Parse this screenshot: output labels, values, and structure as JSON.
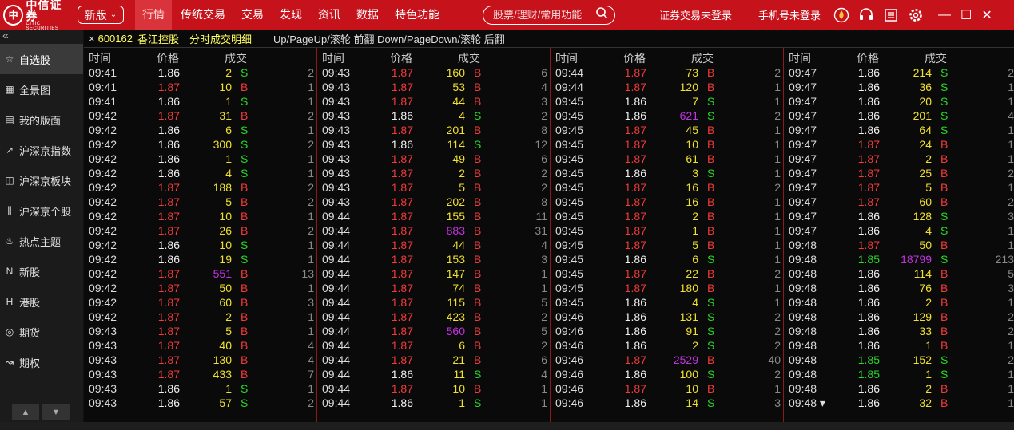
{
  "app": {
    "logo_cn": "中信证券",
    "logo_en": "CITIC SECURITIES",
    "logo_mark": "中"
  },
  "topbar": {
    "version_button": "新版",
    "nav": [
      "行情",
      "传统交易",
      "交易",
      "发现",
      "资讯",
      "数据",
      "特色功能"
    ],
    "active_nav": 0,
    "search_placeholder": "股票/理财/常用功能",
    "trade_login": "证券交易未登录",
    "phone_login": "手机号未登录",
    "icons": [
      "fire-icon",
      "headset-icon",
      "document-icon",
      "gear-icon"
    ],
    "window_buttons": [
      "—",
      "☐",
      "✕"
    ],
    "accent": "#c6121b"
  },
  "sidebar": {
    "collapse": "«",
    "items": [
      {
        "label": "自选股",
        "icon": "star-icon",
        "active": true
      },
      {
        "label": "全景图",
        "icon": "chart-icon",
        "active": false
      },
      {
        "label": "我的版面",
        "icon": "layout-icon",
        "active": false
      },
      {
        "label": "沪深京指数",
        "icon": "trend-icon",
        "active": false
      },
      {
        "label": "沪深京板块",
        "icon": "blocks-icon",
        "active": false
      },
      {
        "label": "沪深京个股",
        "icon": "candle-icon",
        "active": false
      },
      {
        "label": "热点主题",
        "icon": "flame-icon",
        "active": false
      },
      {
        "label": "新股",
        "icon": "new-icon",
        "active": false
      },
      {
        "label": "港股",
        "icon": "hk-icon",
        "active": false
      },
      {
        "label": "期货",
        "icon": "futures-icon",
        "active": false
      },
      {
        "label": "期权",
        "icon": "options-icon",
        "active": false
      }
    ],
    "pager": [
      "▲",
      "▼"
    ]
  },
  "title": {
    "close": "×",
    "code": "600162",
    "name": "香江控股",
    "subtitle": "分时成交明细",
    "hint": "Up/PageUp/滚轮 前翻 Down/PageDown/滚轮 后翻"
  },
  "table": {
    "headers": [
      "时间",
      "价格",
      "成交"
    ],
    "columns": [
      [
        [
          "09:41",
          "1.86",
          "2",
          "S",
          "2"
        ],
        [
          "09:41",
          "1.87",
          "10",
          "B",
          "1"
        ],
        [
          "09:41",
          "1.86",
          "1",
          "S",
          "1"
        ],
        [
          "09:42",
          "1.87",
          "31",
          "B",
          "2"
        ],
        [
          "09:42",
          "1.86",
          "6",
          "S",
          "1"
        ],
        [
          "09:42",
          "1.86",
          "300",
          "S",
          "2"
        ],
        [
          "09:42",
          "1.86",
          "1",
          "S",
          "1"
        ],
        [
          "09:42",
          "1.86",
          "4",
          "S",
          "1"
        ],
        [
          "09:42",
          "1.87",
          "188",
          "B",
          "2"
        ],
        [
          "09:42",
          "1.87",
          "5",
          "B",
          "2"
        ],
        [
          "09:42",
          "1.87",
          "10",
          "B",
          "1"
        ],
        [
          "09:42",
          "1.87",
          "26",
          "B",
          "2"
        ],
        [
          "09:42",
          "1.86",
          "10",
          "S",
          "1"
        ],
        [
          "09:42",
          "1.86",
          "19",
          "S",
          "1"
        ],
        [
          "09:42",
          "1.87",
          "551",
          "B",
          "13"
        ],
        [
          "09:42",
          "1.87",
          "50",
          "B",
          "1"
        ],
        [
          "09:42",
          "1.87",
          "60",
          "B",
          "3"
        ],
        [
          "09:42",
          "1.87",
          "2",
          "B",
          "1"
        ],
        [
          "09:43",
          "1.87",
          "5",
          "B",
          "1"
        ],
        [
          "09:43",
          "1.87",
          "40",
          "B",
          "4"
        ],
        [
          "09:43",
          "1.87",
          "130",
          "B",
          "4"
        ],
        [
          "09:43",
          "1.87",
          "433",
          "B",
          "7"
        ],
        [
          "09:43",
          "1.86",
          "1",
          "S",
          "1"
        ],
        [
          "09:43",
          "1.86",
          "57",
          "S",
          "2"
        ]
      ],
      [
        [
          "09:43",
          "1.87",
          "160",
          "B",
          "6"
        ],
        [
          "09:43",
          "1.87",
          "53",
          "B",
          "4"
        ],
        [
          "09:43",
          "1.87",
          "44",
          "B",
          "3"
        ],
        [
          "09:43",
          "1.86",
          "4",
          "S",
          "2"
        ],
        [
          "09:43",
          "1.87",
          "201",
          "B",
          "8"
        ],
        [
          "09:43",
          "1.86",
          "114",
          "S",
          "12"
        ],
        [
          "09:43",
          "1.87",
          "49",
          "B",
          "6"
        ],
        [
          "09:43",
          "1.87",
          "2",
          "B",
          "2"
        ],
        [
          "09:43",
          "1.87",
          "5",
          "B",
          "2"
        ],
        [
          "09:43",
          "1.87",
          "202",
          "B",
          "8"
        ],
        [
          "09:44",
          "1.87",
          "155",
          "B",
          "11"
        ],
        [
          "09:44",
          "1.87",
          "883",
          "B",
          "31"
        ],
        [
          "09:44",
          "1.87",
          "44",
          "B",
          "4"
        ],
        [
          "09:44",
          "1.87",
          "153",
          "B",
          "3"
        ],
        [
          "09:44",
          "1.87",
          "147",
          "B",
          "1"
        ],
        [
          "09:44",
          "1.87",
          "74",
          "B",
          "1"
        ],
        [
          "09:44",
          "1.87",
          "115",
          "B",
          "5"
        ],
        [
          "09:44",
          "1.87",
          "423",
          "B",
          "2"
        ],
        [
          "09:44",
          "1.87",
          "560",
          "B",
          "5"
        ],
        [
          "09:44",
          "1.87",
          "6",
          "B",
          "2"
        ],
        [
          "09:44",
          "1.87",
          "21",
          "B",
          "6"
        ],
        [
          "09:44",
          "1.86",
          "11",
          "S",
          "4"
        ],
        [
          "09:44",
          "1.87",
          "10",
          "B",
          "1"
        ],
        [
          "09:44",
          "1.86",
          "1",
          "S",
          "1"
        ]
      ],
      [
        [
          "09:44",
          "1.87",
          "73",
          "B",
          "2"
        ],
        [
          "09:44",
          "1.87",
          "120",
          "B",
          "1"
        ],
        [
          "09:45",
          "1.86",
          "7",
          "S",
          "1"
        ],
        [
          "09:45",
          "1.86",
          "621",
          "S",
          "2"
        ],
        [
          "09:45",
          "1.87",
          "45",
          "B",
          "1"
        ],
        [
          "09:45",
          "1.87",
          "10",
          "B",
          "1"
        ],
        [
          "09:45",
          "1.87",
          "61",
          "B",
          "1"
        ],
        [
          "09:45",
          "1.86",
          "3",
          "S",
          "1"
        ],
        [
          "09:45",
          "1.87",
          "16",
          "B",
          "2"
        ],
        [
          "09:45",
          "1.87",
          "16",
          "B",
          "1"
        ],
        [
          "09:45",
          "1.87",
          "2",
          "B",
          "1"
        ],
        [
          "09:45",
          "1.87",
          "1",
          "B",
          "1"
        ],
        [
          "09:45",
          "1.87",
          "5",
          "B",
          "1"
        ],
        [
          "09:45",
          "1.86",
          "6",
          "S",
          "1"
        ],
        [
          "09:45",
          "1.87",
          "22",
          "B",
          "2"
        ],
        [
          "09:45",
          "1.87",
          "180",
          "B",
          "1"
        ],
        [
          "09:45",
          "1.86",
          "4",
          "S",
          "1"
        ],
        [
          "09:46",
          "1.86",
          "131",
          "S",
          "2"
        ],
        [
          "09:46",
          "1.86",
          "91",
          "S",
          "2"
        ],
        [
          "09:46",
          "1.86",
          "2",
          "S",
          "2"
        ],
        [
          "09:46",
          "1.87",
          "2529",
          "B",
          "40"
        ],
        [
          "09:46",
          "1.86",
          "100",
          "S",
          "2"
        ],
        [
          "09:46",
          "1.87",
          "10",
          "B",
          "1"
        ],
        [
          "09:46",
          "1.86",
          "14",
          "S",
          "3"
        ]
      ],
      [
        [
          "09:47",
          "1.86",
          "214",
          "S",
          "2"
        ],
        [
          "09:47",
          "1.86",
          "36",
          "S",
          "1"
        ],
        [
          "09:47",
          "1.86",
          "20",
          "S",
          "1"
        ],
        [
          "09:47",
          "1.86",
          "201",
          "S",
          "4"
        ],
        [
          "09:47",
          "1.86",
          "64",
          "S",
          "1"
        ],
        [
          "09:47",
          "1.87",
          "24",
          "B",
          "1"
        ],
        [
          "09:47",
          "1.87",
          "2",
          "B",
          "1"
        ],
        [
          "09:47",
          "1.87",
          "25",
          "B",
          "2"
        ],
        [
          "09:47",
          "1.87",
          "5",
          "B",
          "1"
        ],
        [
          "09:47",
          "1.87",
          "60",
          "B",
          "2"
        ],
        [
          "09:47",
          "1.86",
          "128",
          "S",
          "3"
        ],
        [
          "09:47",
          "1.86",
          "4",
          "S",
          "1"
        ],
        [
          "09:48",
          "1.87",
          "50",
          "B",
          "1"
        ],
        [
          "09:48",
          "1.85",
          "18799",
          "S",
          "213"
        ],
        [
          "09:48",
          "1.86",
          "114",
          "B",
          "5"
        ],
        [
          "09:48",
          "1.86",
          "76",
          "B",
          "3"
        ],
        [
          "09:48",
          "1.86",
          "2",
          "B",
          "1"
        ],
        [
          "09:48",
          "1.86",
          "129",
          "B",
          "2"
        ],
        [
          "09:48",
          "1.86",
          "33",
          "B",
          "2"
        ],
        [
          "09:48",
          "1.86",
          "1",
          "B",
          "1"
        ],
        [
          "09:48",
          "1.85",
          "152",
          "S",
          "2"
        ],
        [
          "09:48",
          "1.85",
          "1",
          "S",
          "1"
        ],
        [
          "09:48",
          "1.86",
          "2",
          "B",
          "1"
        ],
        [
          "09:48 ▾",
          "1.86",
          "32",
          "B",
          "1"
        ]
      ]
    ]
  },
  "colors": {
    "up": "#f23a3a",
    "flat": "#f2f2f2",
    "down": "#27d827",
    "volume": "#f0e030",
    "big_volume": "#c433e3",
    "col_divider": "#8b1a1a"
  }
}
